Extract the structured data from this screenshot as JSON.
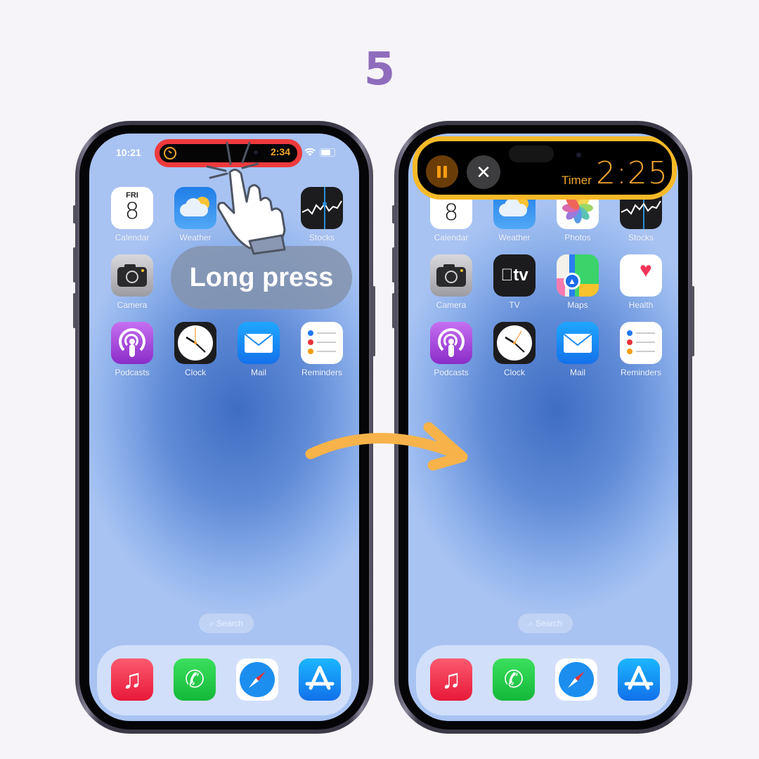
{
  "step": {
    "number": "5"
  },
  "hint": {
    "text": "Long press"
  },
  "before_phone": {
    "status_time": "10:21",
    "live_activity": {
      "timer_remaining": "2:34",
      "icon": "timer-icon",
      "highlight_color": "#ee3a3c"
    },
    "apps": [
      {
        "label": "Calendar",
        "day": "FRI",
        "date": "8"
      },
      {
        "label": "Weather"
      },
      {
        "label": "Stocks"
      },
      {
        "label": "Camera"
      },
      {
        "label": "Podcasts"
      },
      {
        "label": "Clock"
      },
      {
        "label": "Mail"
      },
      {
        "label": "Reminders"
      }
    ],
    "search_label": "Search",
    "dock": [
      "Music",
      "Phone",
      "Safari",
      "App Store"
    ]
  },
  "after_phone": {
    "expanded_activity": {
      "title": "Timer",
      "timer_remaining": "2:25",
      "pause_icon": "pause-icon",
      "close_icon": "close-icon",
      "highlight_color": "#f7b928"
    },
    "apps": [
      {
        "label": "Calendar",
        "date": "8"
      },
      {
        "label": "Weather"
      },
      {
        "label": "Photos"
      },
      {
        "label": "Stocks"
      },
      {
        "label": "Camera"
      },
      {
        "label": "TV",
        "icon_text": "tv"
      },
      {
        "label": "Maps"
      },
      {
        "label": "Health"
      },
      {
        "label": "Podcasts"
      },
      {
        "label": "Clock"
      },
      {
        "label": "Mail"
      },
      {
        "label": "Reminders"
      }
    ],
    "search_label": "Search",
    "dock": [
      "Music",
      "Phone",
      "Safari",
      "App Store"
    ]
  },
  "colors": {
    "accent_purple": "#8f6cbc",
    "arrow_orange": "#f7b34a"
  }
}
